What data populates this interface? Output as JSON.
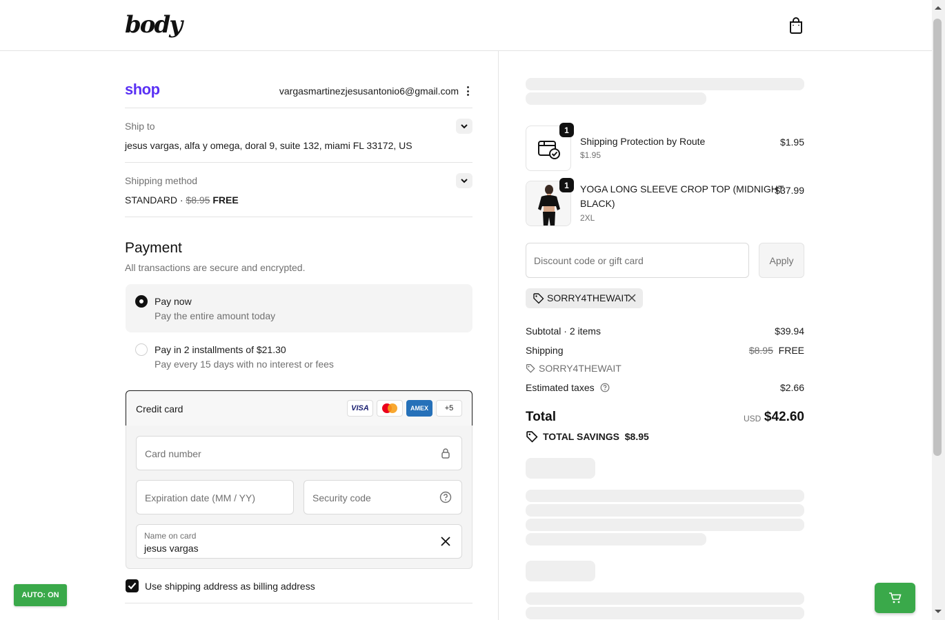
{
  "header": {
    "logo_text": "body",
    "cart_icon": "shopping-bag-icon"
  },
  "account": {
    "shop_logo": "shop",
    "email": "vargasmartinezjesusantonio6@gmail.com"
  },
  "ship_to": {
    "label": "Ship to",
    "value": "jesus vargas, alfa y omega, doral 9, suite 132, miami FL 33172, US"
  },
  "shipping_method": {
    "label": "Shipping method",
    "name": "STANDARD · ",
    "old_price": "$8.95",
    "new_price": "FREE"
  },
  "payment": {
    "title": "Payment",
    "subtitle": "All transactions are secure and encrypted.",
    "options": [
      {
        "title": "Pay now",
        "subtitle": "Pay the entire amount today",
        "selected": true
      },
      {
        "title": "Pay in 2 installments of $21.30",
        "subtitle": "Pay every 15 days with no interest or fees",
        "selected": false
      }
    ],
    "credit_card": {
      "label": "Credit card",
      "brands": [
        "VISA",
        "MC",
        "AMEX",
        "+5"
      ],
      "card_number_placeholder": "Card number",
      "expiry_placeholder": "Expiration date (MM / YY)",
      "security_placeholder": "Security code",
      "name_label": "Name on card",
      "name_value": "jesus vargas"
    },
    "billing_checkbox_label": "Use shipping address as billing address",
    "billing_checked": true
  },
  "auto_button": "AUTO: ON",
  "order": {
    "items": [
      {
        "qty": "1",
        "name": "Shipping Protection by Route",
        "variant": "$1.95",
        "price": "$1.95",
        "icon": "package-check-icon"
      },
      {
        "qty": "1",
        "name_line1": "YOGA LONG SLEEVE CROP TOP (MIDNIGHT",
        "name_line2": "BLACK)",
        "variant": "2XL",
        "price": "$37.99",
        "icon": "product-photo"
      }
    ],
    "discount_placeholder": "Discount code or gift card",
    "apply_label": "Apply",
    "applied_code": "SORRY4THEWAIT",
    "subtotal_label": "Subtotal · 2 items",
    "subtotal_value": "$39.94",
    "shipping_label": "Shipping",
    "shipping_old": "$8.95",
    "shipping_new": "FREE",
    "shipping_code": "SORRY4THEWAIT",
    "taxes_label": "Estimated taxes",
    "taxes_value": "$2.66",
    "total_label": "Total",
    "total_currency": "USD",
    "total_value": "$42.60",
    "savings_label": "TOTAL SAVINGS",
    "savings_value": "$8.95"
  },
  "colors": {
    "accent": "#111111",
    "shop_purple": "#5a31f4",
    "green_button": "#3aa94a"
  }
}
